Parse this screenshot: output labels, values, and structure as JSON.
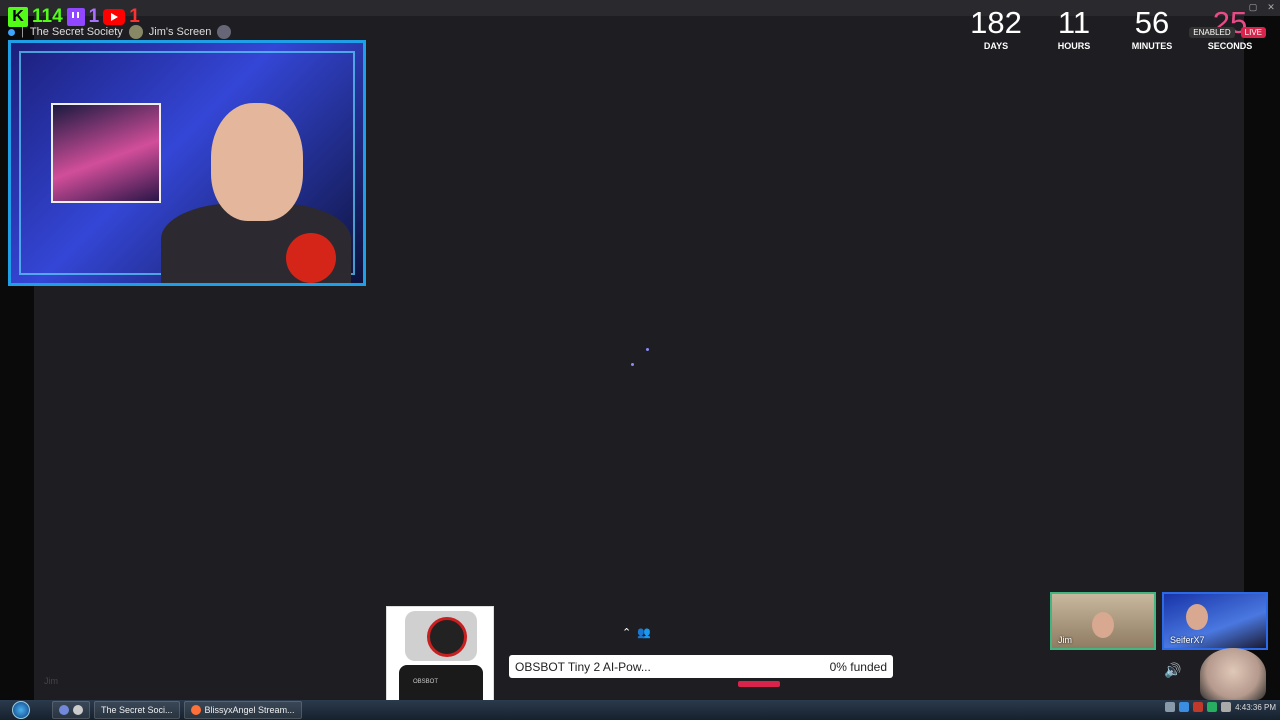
{
  "stats": {
    "kick_count": "114",
    "twitch_count": "1",
    "youtube_count": "1"
  },
  "server_bar": {
    "server_name": "The Secret Society",
    "screen_label": "Jim's Screen"
  },
  "countdown": {
    "days": "182",
    "days_label": "DAYS",
    "hours": "11",
    "hours_label": "HOURS",
    "minutes": "56",
    "minutes_label": "MINUTES",
    "seconds": "25",
    "seconds_label": "SECONDS",
    "enabled_badge": "ENABLED",
    "live_badge": "LIVE"
  },
  "participants": [
    {
      "name": "Jim"
    },
    {
      "name": "SeiferX7"
    }
  ],
  "funding": {
    "product_title": "OBSBOT Tiny 2 AI-Pow...",
    "progress_text": "0% funded",
    "progress": 0,
    "brand_text": "OBSBOT"
  },
  "ghost_label": "Jim",
  "taskbar": {
    "items": [
      {
        "label": "The Secret Soci..."
      },
      {
        "label": "BlissyxAngel Stream..."
      }
    ],
    "clock": "4:43:36 PM"
  },
  "colors": {
    "kick": "#53fc18",
    "twitch": "#9146ff",
    "youtube": "#ff0000",
    "frame_border": "#1e9fe8",
    "seconds_accent": "#e84b86",
    "live_badge": "#d8244a"
  }
}
